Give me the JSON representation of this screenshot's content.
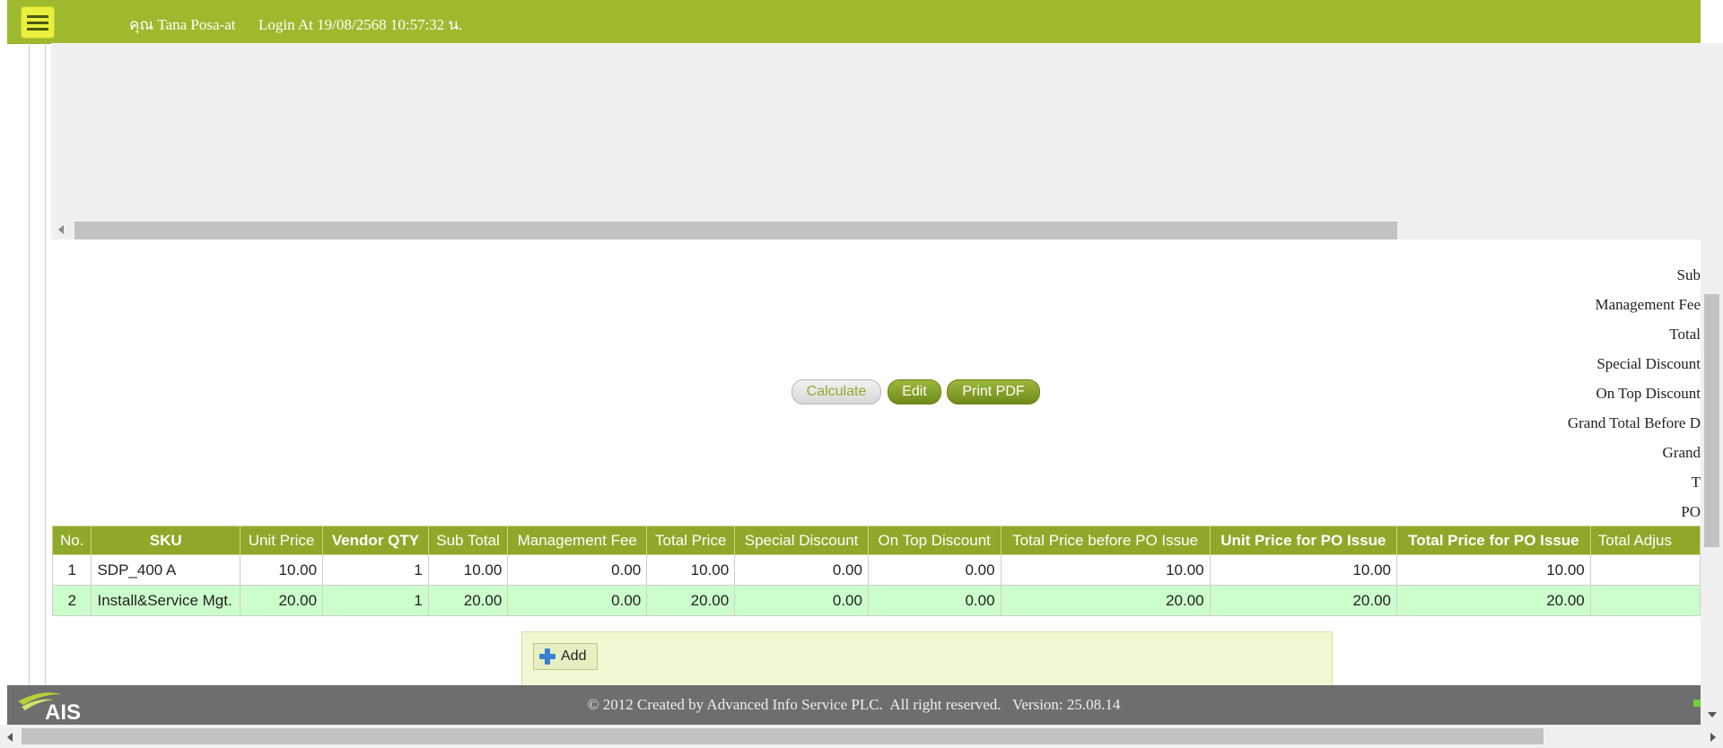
{
  "header": {
    "user_label": "คุณ Tana Posa-at",
    "login_label": "Login At 19/08/2568 10:57:32 น.",
    "menu_icon": "hamburger-menu-icon",
    "bar_color": "#9dba2e"
  },
  "summary_labels": [
    "Sub",
    "Management Fee",
    "Total",
    "Special Discount",
    "On Top Discount",
    "Grand Total Before D",
    "Grand",
    "T",
    "PO"
  ],
  "actions": {
    "calculate": "Calculate",
    "edit": "Edit",
    "print_pdf": "Print PDF"
  },
  "table": {
    "headers": [
      "No.",
      "SKU",
      "Unit Price",
      "Vendor QTY",
      "Sub Total",
      "Management Fee",
      "Total Price",
      "Special Discount",
      "On Top Discount",
      "Total Price before PO Issue",
      "Unit Price for PO Issue",
      "Total Price for PO Issue",
      "Total Adjus"
    ],
    "rows": [
      [
        "1",
        "SDP_400 A",
        "10.00",
        "1",
        "10.00",
        "0.00",
        "10.00",
        "0.00",
        "0.00",
        "10.00",
        "10.00",
        "10.00",
        ""
      ],
      [
        "2",
        "Install&Service Mgt.",
        "20.00",
        "1",
        "20.00",
        "0.00",
        "20.00",
        "0.00",
        "0.00",
        "20.00",
        "20.00",
        "20.00",
        ""
      ]
    ],
    "header_color": "#8fa829",
    "alt_row_color": "#ccfecc"
  },
  "add_button": "Add",
  "footer": {
    "logo_text": "AIS",
    "copyright": "© 2012 Created by Advanced Info Service PLC.  All right reserved.   Version: 25.08.14"
  }
}
